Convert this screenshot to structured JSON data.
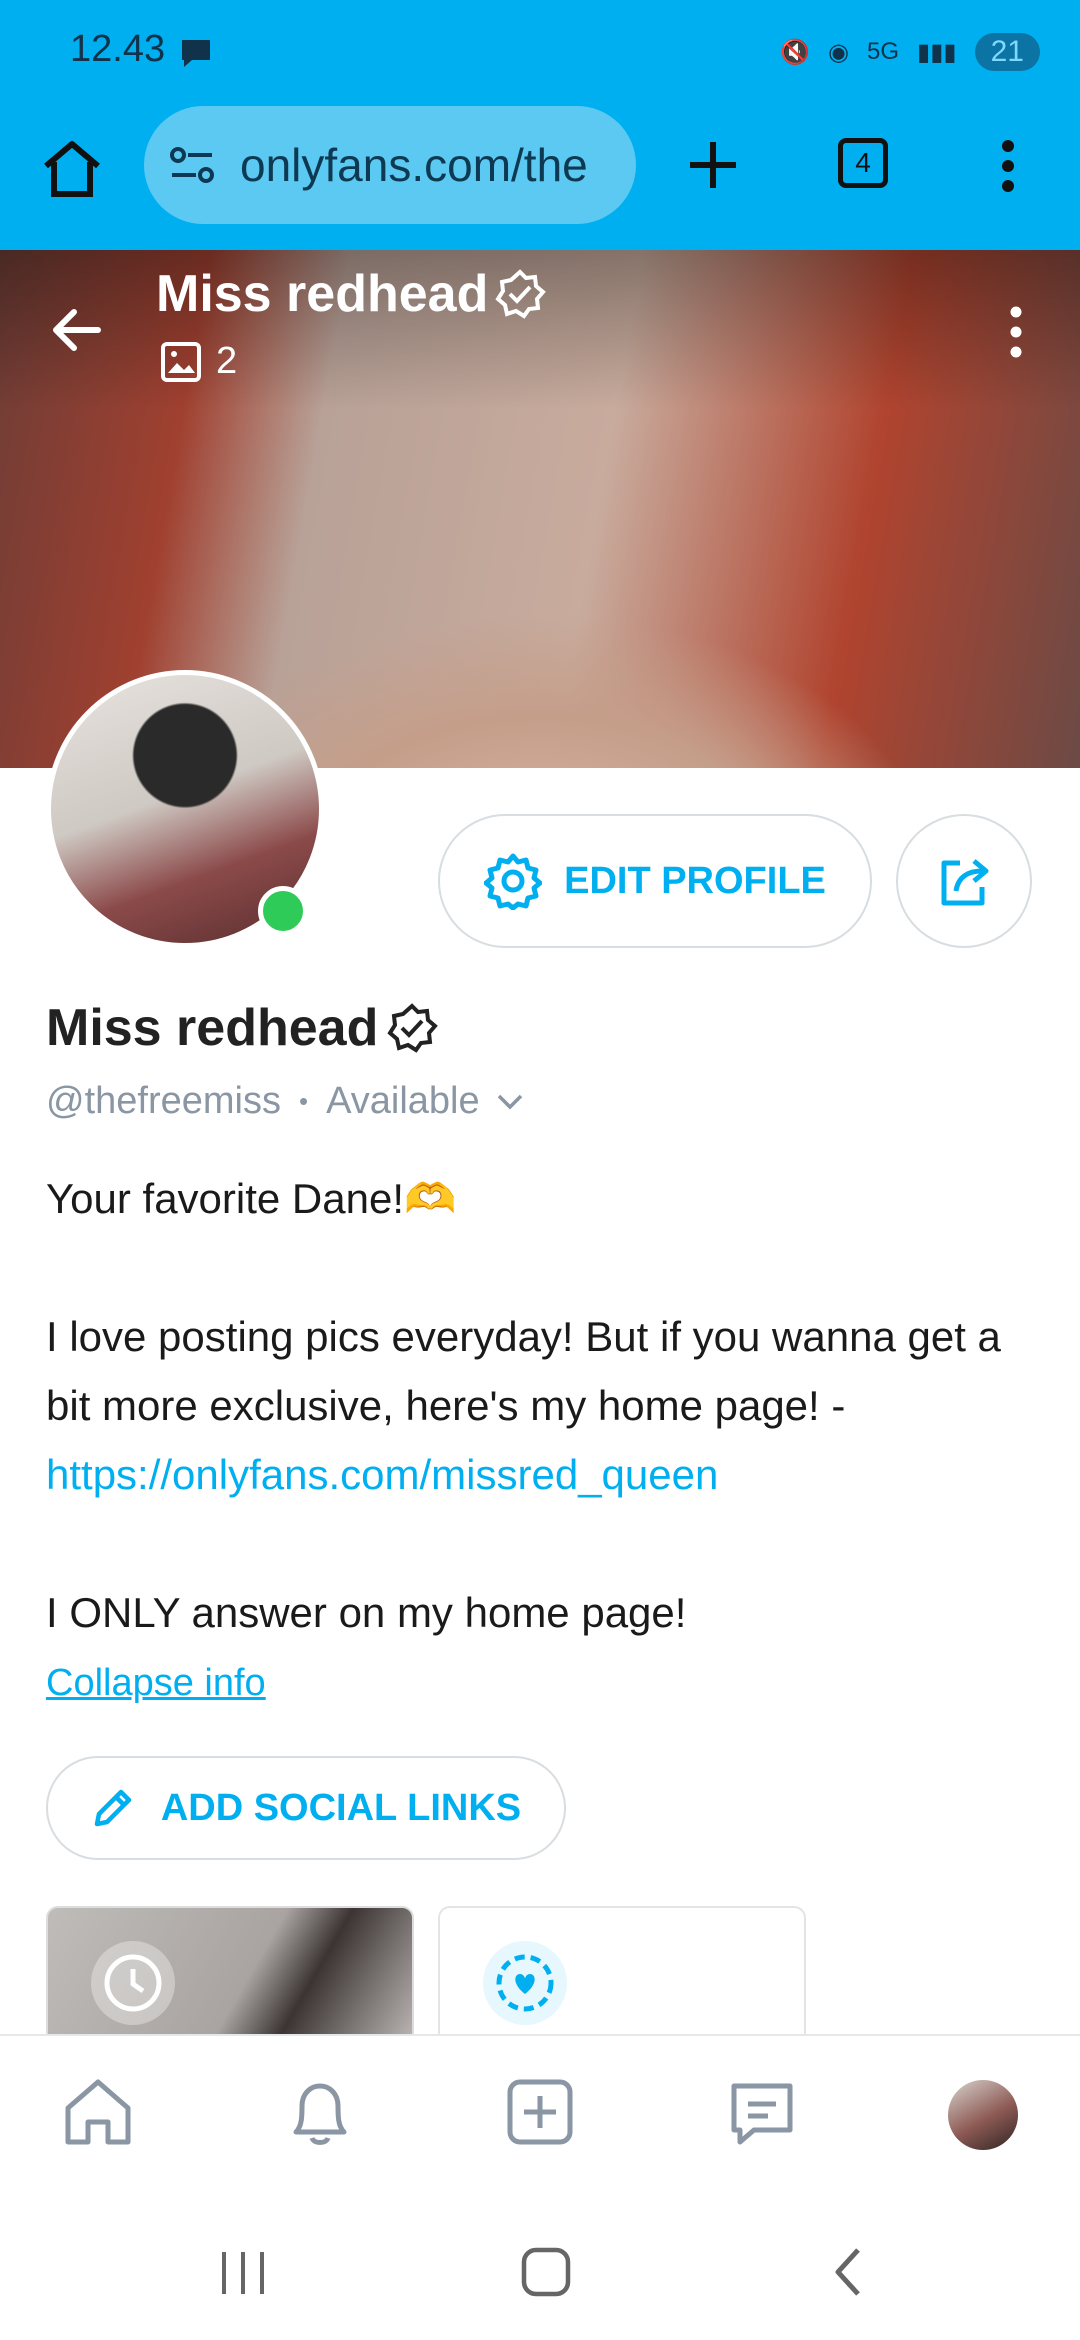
{
  "status_bar": {
    "time": "12.43",
    "network": "5G",
    "battery": "21"
  },
  "browser": {
    "url": "onlyfans.com/the",
    "tab_count": "4"
  },
  "profile": {
    "cover_title": "Miss redhead",
    "media_count": "2",
    "display_name": "Miss redhead",
    "handle": "@thefreemiss",
    "separator": "•",
    "availability": "Available",
    "edit_profile_label": "EDIT PROFILE",
    "bio": {
      "line1": "Your favorite Dane!🫶",
      "line2": "I love posting pics everyday! But if you wanna get a bit more exclusive, here's my home page! -",
      "link": "https://onlyfans.com/missred_queen",
      "line3": "I ONLY answer on my home page!"
    },
    "collapse_label": "Collapse info",
    "add_social_label": "ADD SOCIAL LINKS"
  },
  "colors": {
    "brand": "#00aff0",
    "online": "#2fcb58"
  },
  "icons": [
    "home-icon",
    "site-settings-icon",
    "plus-icon",
    "tabs-icon",
    "more-vert-icon",
    "back-arrow-icon",
    "verified-icon",
    "image-icon",
    "gear-icon",
    "share-icon",
    "chevron-down-icon",
    "pencil-icon",
    "clock-icon",
    "heart-icon",
    "bell-icon",
    "add-post-icon",
    "chat-icon"
  ]
}
